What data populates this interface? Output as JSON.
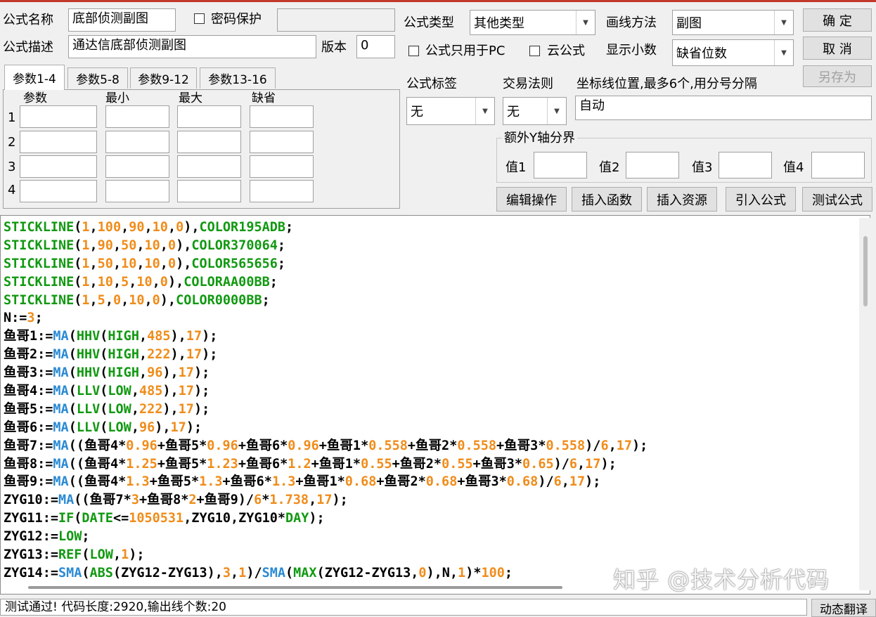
{
  "form": {
    "name_label": "公式名称",
    "name_value": "底部侦测副图",
    "password_label": "密码保护",
    "password_value": "",
    "desc_label": "公式描述",
    "desc_value": "通达信底部侦测副图",
    "version_label": "版本",
    "version_value": "0",
    "type_label": "公式类型",
    "type_value": "其他类型",
    "pc_only_label": "公式只用于PC",
    "cloud_label": "云公式",
    "draw_label": "画线方法",
    "draw_value": "副图",
    "decimals_label": "显示小数",
    "decimals_value": "缺省位数",
    "ok_label": "确  定",
    "cancel_label": "取  消",
    "save_as_label": "另存为",
    "tag_label": "公式标签",
    "tag_value": "无",
    "trade_label": "交易法则",
    "trade_value": "无",
    "axis_label": "坐标线位置,最多6个,用分号分隔",
    "axis_value": "自动",
    "extra_y_label": "额外Y轴分界",
    "value_labels": [
      "值1",
      "值2",
      "值3",
      "值4"
    ]
  },
  "params": {
    "tabs": [
      "参数1-4",
      "参数5-8",
      "参数9-12",
      "参数13-16"
    ],
    "headers": [
      "参数",
      "最小",
      "最大",
      "缺省"
    ],
    "rows": [
      "1",
      "2",
      "3",
      "4"
    ]
  },
  "toolbar": {
    "edit_ops": "编辑操作",
    "insert_func": "插入函数",
    "insert_resource": "插入资源",
    "import_formula": "引入公式",
    "test_formula": "测试公式"
  },
  "code_lines": [
    [
      [
        "kw",
        "STICKLINE"
      ],
      [
        "punct",
        "("
      ],
      [
        "num",
        "1"
      ],
      [
        "punct",
        ","
      ],
      [
        "num",
        "100"
      ],
      [
        "punct",
        ","
      ],
      [
        "num",
        "90"
      ],
      [
        "punct",
        ","
      ],
      [
        "num",
        "10"
      ],
      [
        "punct",
        ","
      ],
      [
        "num",
        "0"
      ],
      [
        "punct",
        "),"
      ],
      [
        "kw",
        "COLOR195ADB"
      ],
      [
        "punct",
        ";"
      ]
    ],
    [
      [
        "kw",
        "STICKLINE"
      ],
      [
        "punct",
        "("
      ],
      [
        "num",
        "1"
      ],
      [
        "punct",
        ","
      ],
      [
        "num",
        "90"
      ],
      [
        "punct",
        ","
      ],
      [
        "num",
        "50"
      ],
      [
        "punct",
        ","
      ],
      [
        "num",
        "10"
      ],
      [
        "punct",
        ","
      ],
      [
        "num",
        "0"
      ],
      [
        "punct",
        "),"
      ],
      [
        "kw",
        "COLOR370064"
      ],
      [
        "punct",
        ";"
      ]
    ],
    [
      [
        "kw",
        "STICKLINE"
      ],
      [
        "punct",
        "("
      ],
      [
        "num",
        "1"
      ],
      [
        "punct",
        ","
      ],
      [
        "num",
        "50"
      ],
      [
        "punct",
        ","
      ],
      [
        "num",
        "10"
      ],
      [
        "punct",
        ","
      ],
      [
        "num",
        "10"
      ],
      [
        "punct",
        ","
      ],
      [
        "num",
        "0"
      ],
      [
        "punct",
        "),"
      ],
      [
        "kw",
        "COLOR565656"
      ],
      [
        "punct",
        ";"
      ]
    ],
    [
      [
        "kw",
        "STICKLINE"
      ],
      [
        "punct",
        "("
      ],
      [
        "num",
        "1"
      ],
      [
        "punct",
        ","
      ],
      [
        "num",
        "10"
      ],
      [
        "punct",
        ","
      ],
      [
        "num",
        "5"
      ],
      [
        "punct",
        ","
      ],
      [
        "num",
        "10"
      ],
      [
        "punct",
        ","
      ],
      [
        "num",
        "0"
      ],
      [
        "punct",
        "),"
      ],
      [
        "kw",
        "COLORAA00BB"
      ],
      [
        "punct",
        ";"
      ]
    ],
    [
      [
        "kw",
        "STICKLINE"
      ],
      [
        "punct",
        "("
      ],
      [
        "num",
        "1"
      ],
      [
        "punct",
        ","
      ],
      [
        "num",
        "5"
      ],
      [
        "punct",
        ","
      ],
      [
        "num",
        "0"
      ],
      [
        "punct",
        ","
      ],
      [
        "num",
        "10"
      ],
      [
        "punct",
        ","
      ],
      [
        "num",
        "0"
      ],
      [
        "punct",
        "),"
      ],
      [
        "kw",
        "COLOR0000BB"
      ],
      [
        "punct",
        ";"
      ]
    ],
    [
      [
        "ident",
        "N:="
      ],
      [
        "num",
        "3"
      ],
      [
        "punct",
        ";"
      ]
    ],
    [
      [
        "ident",
        "鱼哥1:="
      ],
      [
        "fn",
        "MA"
      ],
      [
        "punct",
        "("
      ],
      [
        "kw",
        "HHV"
      ],
      [
        "punct",
        "("
      ],
      [
        "kw",
        "HIGH"
      ],
      [
        "punct",
        ","
      ],
      [
        "num",
        "485"
      ],
      [
        "punct",
        "),"
      ],
      [
        "num",
        "17"
      ],
      [
        "punct",
        ");"
      ]
    ],
    [
      [
        "ident",
        "鱼哥2:="
      ],
      [
        "fn",
        "MA"
      ],
      [
        "punct",
        "("
      ],
      [
        "kw",
        "HHV"
      ],
      [
        "punct",
        "("
      ],
      [
        "kw",
        "HIGH"
      ],
      [
        "punct",
        ","
      ],
      [
        "num",
        "222"
      ],
      [
        "punct",
        "),"
      ],
      [
        "num",
        "17"
      ],
      [
        "punct",
        ");"
      ]
    ],
    [
      [
        "ident",
        "鱼哥3:="
      ],
      [
        "fn",
        "MA"
      ],
      [
        "punct",
        "("
      ],
      [
        "kw",
        "HHV"
      ],
      [
        "punct",
        "("
      ],
      [
        "kw",
        "HIGH"
      ],
      [
        "punct",
        ","
      ],
      [
        "num",
        "96"
      ],
      [
        "punct",
        "),"
      ],
      [
        "num",
        "17"
      ],
      [
        "punct",
        ");"
      ]
    ],
    [
      [
        "ident",
        "鱼哥4:="
      ],
      [
        "fn",
        "MA"
      ],
      [
        "punct",
        "("
      ],
      [
        "kw",
        "LLV"
      ],
      [
        "punct",
        "("
      ],
      [
        "kw",
        "LOW"
      ],
      [
        "punct",
        ","
      ],
      [
        "num",
        "485"
      ],
      [
        "punct",
        "),"
      ],
      [
        "num",
        "17"
      ],
      [
        "punct",
        ");"
      ]
    ],
    [
      [
        "ident",
        "鱼哥5:="
      ],
      [
        "fn",
        "MA"
      ],
      [
        "punct",
        "("
      ],
      [
        "kw",
        "LLV"
      ],
      [
        "punct",
        "("
      ],
      [
        "kw",
        "LOW"
      ],
      [
        "punct",
        ","
      ],
      [
        "num",
        "222"
      ],
      [
        "punct",
        "),"
      ],
      [
        "num",
        "17"
      ],
      [
        "punct",
        ");"
      ]
    ],
    [
      [
        "ident",
        "鱼哥6:="
      ],
      [
        "fn",
        "MA"
      ],
      [
        "punct",
        "("
      ],
      [
        "kw",
        "LLV"
      ],
      [
        "punct",
        "("
      ],
      [
        "kw",
        "LOW"
      ],
      [
        "punct",
        ","
      ],
      [
        "num",
        "96"
      ],
      [
        "punct",
        "),"
      ],
      [
        "num",
        "17"
      ],
      [
        "punct",
        ");"
      ]
    ],
    [
      [
        "ident",
        "鱼哥7:="
      ],
      [
        "fn",
        "MA"
      ],
      [
        "punct",
        "((鱼哥4*"
      ],
      [
        "num",
        "0.96"
      ],
      [
        "punct",
        "+鱼哥5*"
      ],
      [
        "num",
        "0.96"
      ],
      [
        "punct",
        "+鱼哥6*"
      ],
      [
        "num",
        "0.96"
      ],
      [
        "punct",
        "+鱼哥1*"
      ],
      [
        "num",
        "0.558"
      ],
      [
        "punct",
        "+鱼哥2*"
      ],
      [
        "num",
        "0.558"
      ],
      [
        "punct",
        "+鱼哥3*"
      ],
      [
        "num",
        "0.558"
      ],
      [
        "punct",
        ")/"
      ],
      [
        "num",
        "6"
      ],
      [
        "punct",
        ","
      ],
      [
        "num",
        "17"
      ],
      [
        "punct",
        ");"
      ]
    ],
    [
      [
        "ident",
        "鱼哥8:="
      ],
      [
        "fn",
        "MA"
      ],
      [
        "punct",
        "((鱼哥4*"
      ],
      [
        "num",
        "1.25"
      ],
      [
        "punct",
        "+鱼哥5*"
      ],
      [
        "num",
        "1.23"
      ],
      [
        "punct",
        "+鱼哥6*"
      ],
      [
        "num",
        "1.2"
      ],
      [
        "punct",
        "+鱼哥1*"
      ],
      [
        "num",
        "0.55"
      ],
      [
        "punct",
        "+鱼哥2*"
      ],
      [
        "num",
        "0.55"
      ],
      [
        "punct",
        "+鱼哥3*"
      ],
      [
        "num",
        "0.65"
      ],
      [
        "punct",
        ")/"
      ],
      [
        "num",
        "6"
      ],
      [
        "punct",
        ","
      ],
      [
        "num",
        "17"
      ],
      [
        "punct",
        ");"
      ]
    ],
    [
      [
        "ident",
        "鱼哥9:="
      ],
      [
        "fn",
        "MA"
      ],
      [
        "punct",
        "((鱼哥4*"
      ],
      [
        "num",
        "1.3"
      ],
      [
        "punct",
        "+鱼哥5*"
      ],
      [
        "num",
        "1.3"
      ],
      [
        "punct",
        "+鱼哥6*"
      ],
      [
        "num",
        "1.3"
      ],
      [
        "punct",
        "+鱼哥1*"
      ],
      [
        "num",
        "0.68"
      ],
      [
        "punct",
        "+鱼哥2*"
      ],
      [
        "num",
        "0.68"
      ],
      [
        "punct",
        "+鱼哥3*"
      ],
      [
        "num",
        "0.68"
      ],
      [
        "punct",
        ")/"
      ],
      [
        "num",
        "6"
      ],
      [
        "punct",
        ","
      ],
      [
        "num",
        "17"
      ],
      [
        "punct",
        ");"
      ]
    ],
    [
      [
        "ident",
        "ZYG10:="
      ],
      [
        "fn",
        "MA"
      ],
      [
        "punct",
        "((鱼哥7*"
      ],
      [
        "num",
        "3"
      ],
      [
        "punct",
        "+鱼哥8*"
      ],
      [
        "num",
        "2"
      ],
      [
        "punct",
        "+鱼哥9)/"
      ],
      [
        "num",
        "6"
      ],
      [
        "punct",
        "*"
      ],
      [
        "num",
        "1.738"
      ],
      [
        "punct",
        ","
      ],
      [
        "num",
        "17"
      ],
      [
        "punct",
        ");"
      ]
    ],
    [
      [
        "ident",
        "ZYG11:="
      ],
      [
        "kw",
        "IF"
      ],
      [
        "punct",
        "("
      ],
      [
        "kw",
        "DATE"
      ],
      [
        "punct",
        "<="
      ],
      [
        "num",
        "1050531"
      ],
      [
        "punct",
        ",ZYG10,ZYG10*"
      ],
      [
        "kw",
        "DAY"
      ],
      [
        "punct",
        ");"
      ]
    ],
    [
      [
        "ident",
        "ZYG12:="
      ],
      [
        "kw",
        "LOW"
      ],
      [
        "punct",
        ";"
      ]
    ],
    [
      [
        "ident",
        "ZYG13:="
      ],
      [
        "kw",
        "REF"
      ],
      [
        "punct",
        "("
      ],
      [
        "kw",
        "LOW"
      ],
      [
        "punct",
        ","
      ],
      [
        "num",
        "1"
      ],
      [
        "punct",
        ");"
      ]
    ],
    [
      [
        "ident",
        "ZYG14:="
      ],
      [
        "fn",
        "SMA"
      ],
      [
        "punct",
        "("
      ],
      [
        "kw",
        "ABS"
      ],
      [
        "punct",
        "(ZYG12-ZYG13),"
      ],
      [
        "num",
        "3"
      ],
      [
        "punct",
        ","
      ],
      [
        "num",
        "1"
      ],
      [
        "punct",
        ")/"
      ],
      [
        "fn",
        "SMA"
      ],
      [
        "punct",
        "("
      ],
      [
        "kw",
        "MAX"
      ],
      [
        "punct",
        "(ZYG12-ZYG13,"
      ],
      [
        "num",
        "0"
      ],
      [
        "punct",
        "),N,"
      ],
      [
        "num",
        "1"
      ],
      [
        "punct",
        ")*"
      ],
      [
        "num",
        "100"
      ],
      [
        "punct",
        ";"
      ]
    ]
  ],
  "status_text": "测试通过! 代码长度:2920,输出线个数:20",
  "right_button": "动态翻译",
  "watermark": "知乎 @技术分析代码"
}
